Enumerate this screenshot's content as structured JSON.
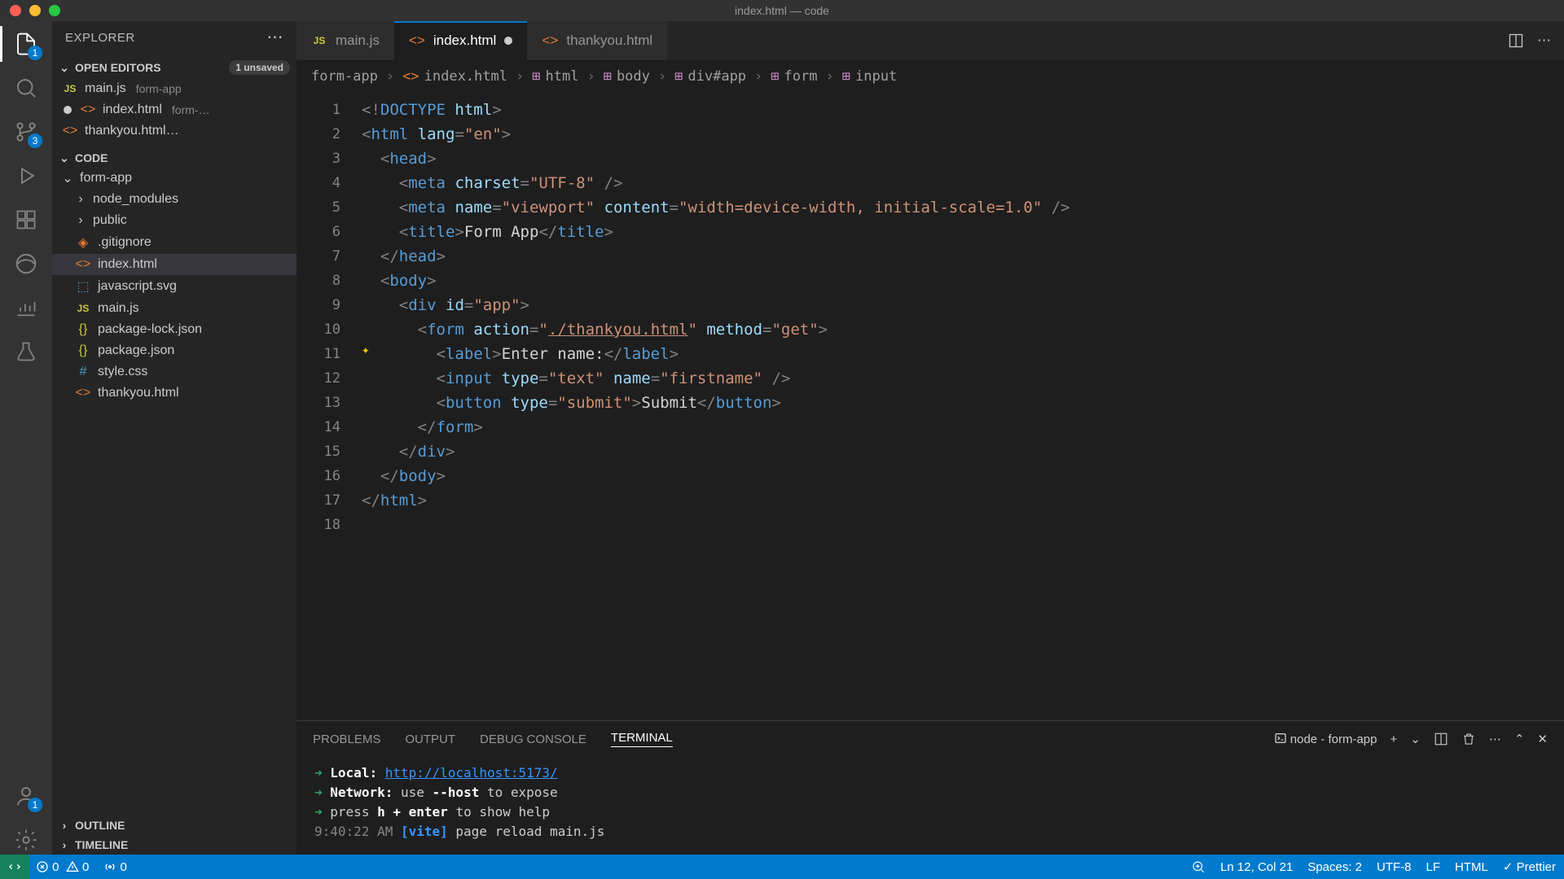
{
  "window": {
    "title": "index.html — code"
  },
  "sidebar": {
    "header": "EXPLORER",
    "open_editors": {
      "title": "OPEN EDITORS",
      "unsaved": "1 unsaved",
      "items": [
        {
          "name": "main.js",
          "dir": "form-app",
          "icon": "JS",
          "modified": false
        },
        {
          "name": "index.html",
          "dir": "form-…",
          "icon": "<>",
          "modified": true
        },
        {
          "name": "thankyou.html…",
          "dir": "",
          "icon": "<>",
          "modified": false
        }
      ]
    },
    "code": {
      "title": "CODE",
      "root": "form-app",
      "items": [
        {
          "name": "node_modules",
          "type": "folder",
          "icon": ">"
        },
        {
          "name": "public",
          "type": "folder",
          "icon": ">"
        },
        {
          "name": ".gitignore",
          "type": "file",
          "icon": "◦"
        },
        {
          "name": "index.html",
          "type": "file",
          "icon": "<>",
          "active": true
        },
        {
          "name": "javascript.svg",
          "type": "file",
          "icon": "⬚"
        },
        {
          "name": "main.js",
          "type": "file",
          "icon": "JS"
        },
        {
          "name": "package-lock.json",
          "type": "file",
          "icon": "{}"
        },
        {
          "name": "package.json",
          "type": "file",
          "icon": "{}"
        },
        {
          "name": "style.css",
          "type": "file",
          "icon": "#"
        },
        {
          "name": "thankyou.html",
          "type": "file",
          "icon": "<>"
        }
      ]
    },
    "outline": "OUTLINE",
    "timeline": "TIMELINE"
  },
  "activity": {
    "badge_files": "1",
    "badge_scm": "3",
    "badge_account": "1"
  },
  "tabs": [
    {
      "name": "main.js",
      "icon": "JS",
      "active": false,
      "modified": false
    },
    {
      "name": "index.html",
      "icon": "<>",
      "active": true,
      "modified": true
    },
    {
      "name": "thankyou.html",
      "icon": "<>",
      "active": false,
      "modified": false
    }
  ],
  "breadcrumbs": [
    "form-app",
    "index.html",
    "html",
    "body",
    "div#app",
    "form",
    "input"
  ],
  "editor": {
    "lines": 18
  },
  "panel": {
    "tabs": [
      "PROBLEMS",
      "OUTPUT",
      "DEBUG CONSOLE",
      "TERMINAL"
    ],
    "active_tab": "TERMINAL",
    "shell": "node - form-app",
    "lines": {
      "local_label": "Local:",
      "local_url": "http://localhost:5173/",
      "network": "Network:",
      "network_hint": "use",
      "network_flag": "--host",
      "network_tail": "to expose",
      "help1": "press",
      "help2": "h + enter",
      "help3": "to show help",
      "timestamp": "9:40:22 AM",
      "vite_tag": "[vite]",
      "reload": "page reload main.js"
    }
  },
  "status": {
    "errors": "0",
    "warnings": "0",
    "ports": "0",
    "cursor": "Ln 12, Col 21",
    "spaces": "Spaces: 2",
    "encoding": "UTF-8",
    "eol": "LF",
    "lang": "HTML",
    "prettier": "Prettier"
  }
}
